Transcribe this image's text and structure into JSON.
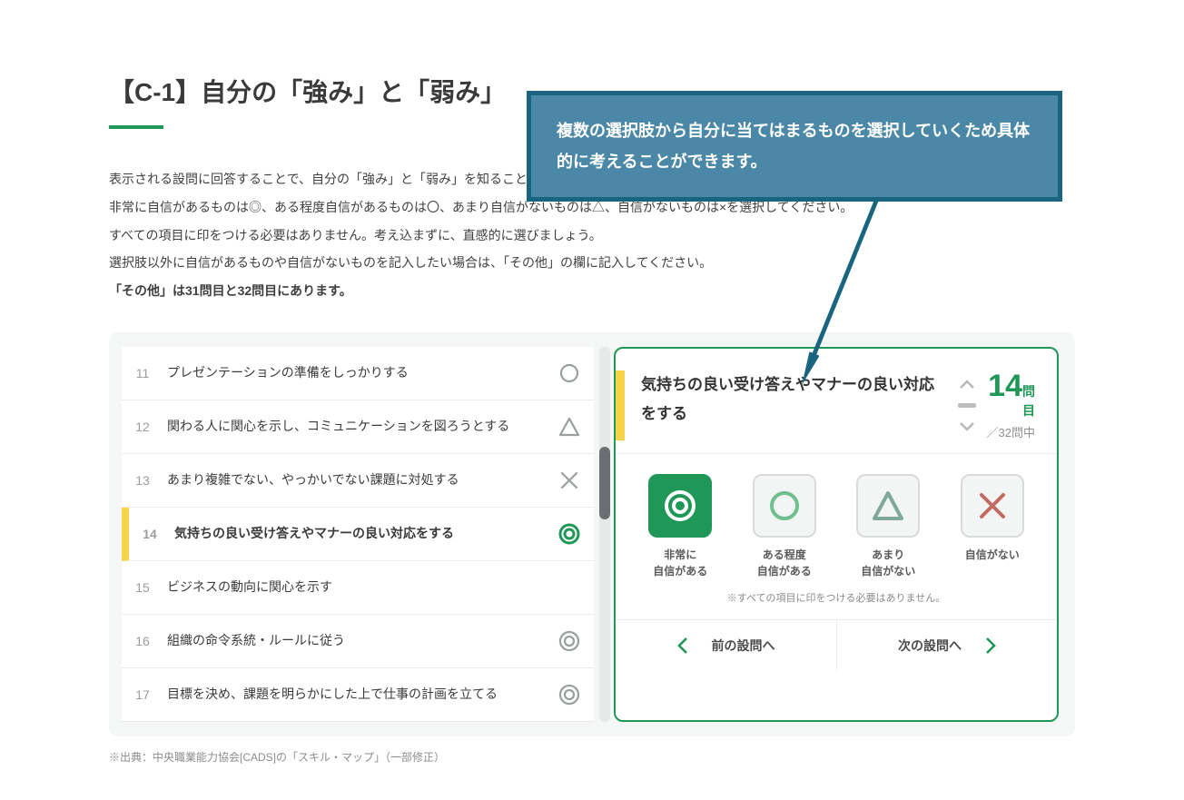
{
  "title": "【C-1】自分の「強み」と「弱み」",
  "intro": {
    "l1": "表示される設問に回答することで、自分の「強み」と「弱み」を知ることができます。",
    "l2": "非常に自信があるものは◎、ある程度自信があるものは〇、あまり自信がないものは△、自信がないものは×を選択してください。",
    "l3": "すべての項目に印をつける必要はありません。考え込まずに、直感的に選びましょう。",
    "l4": "選択肢以外に自信があるものや自信がないものを記入したい場合は、「その他」の欄に記入してください。",
    "l5": "「その他」は31問目と32問目にあります。"
  },
  "tip": "複数の選択肢から自分に当てはまるものを選択していくため具体的に考えることができます。",
  "questions": [
    {
      "n": "11",
      "t": "プレゼンテーションの準備をしっかりする",
      "mark": "circle"
    },
    {
      "n": "12",
      "t": "関わる人に関心を示し、コミュニケーションを図ろうとする",
      "mark": "triangle"
    },
    {
      "n": "13",
      "t": "あまり複雑でない、やっかいでない課題に対処する",
      "mark": "cross"
    },
    {
      "n": "14",
      "t": "気持ちの良い受け答えやマナーの良い対応をする",
      "mark": "double",
      "active": true
    },
    {
      "n": "15",
      "t": "ビジネスの動向に関心を示す",
      "mark": ""
    },
    {
      "n": "16",
      "t": "組織の命令系統・ルールに従う",
      "mark": "double"
    },
    {
      "n": "17",
      "t": "目標を決め、課題を明らかにした上で仕事の計画を立てる",
      "mark": "double"
    }
  ],
  "detail": {
    "text": "気持ちの良い受け答えやマナーの良い対応をする",
    "current": "14",
    "current_suffix": "問目",
    "total": "／32問中",
    "choices": [
      {
        "key": "double",
        "label": "非常に\n自信がある",
        "sel": true
      },
      {
        "key": "circle",
        "label": "ある程度\n自信がある",
        "sel": false
      },
      {
        "key": "triangle",
        "label": "あまり\n自信がない",
        "sel": false
      },
      {
        "key": "cross",
        "label": "自信がない",
        "sel": false
      }
    ],
    "note": "※すべての項目に印をつける必要はありません。",
    "prev": "前の設問へ",
    "next": "次の設問へ"
  },
  "footnote": "※出典：中央職業能力協会[CADS]の「スキル・マップ」（一部修正）",
  "colors": {
    "accent": "#1f9757",
    "highlight": "#f6d34a",
    "tip_bg": "#4b87a6",
    "tip_border": "#19657f"
  }
}
